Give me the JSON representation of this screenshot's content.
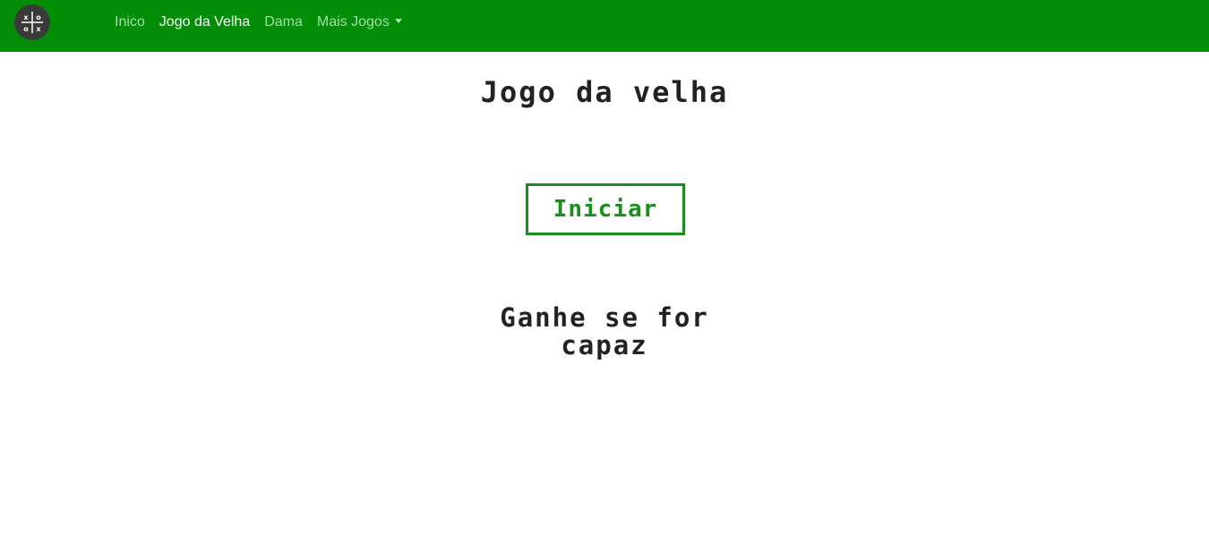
{
  "nav": {
    "logo_icon": "tic-tac-toe-icon",
    "items": [
      {
        "label": "Inico",
        "active": false
      },
      {
        "label": "Jogo da Velha",
        "active": true
      },
      {
        "label": "Dama",
        "active": false
      },
      {
        "label": "Mais Jogos",
        "active": false,
        "dropdown": true
      }
    ]
  },
  "main": {
    "title": "Jogo da velha",
    "start_button": "Iniciar",
    "tagline": "Ganhe se for capaz"
  },
  "colors": {
    "navbar_bg": "#028e07",
    "accent": "#1a8e1f",
    "text": "#222222"
  }
}
